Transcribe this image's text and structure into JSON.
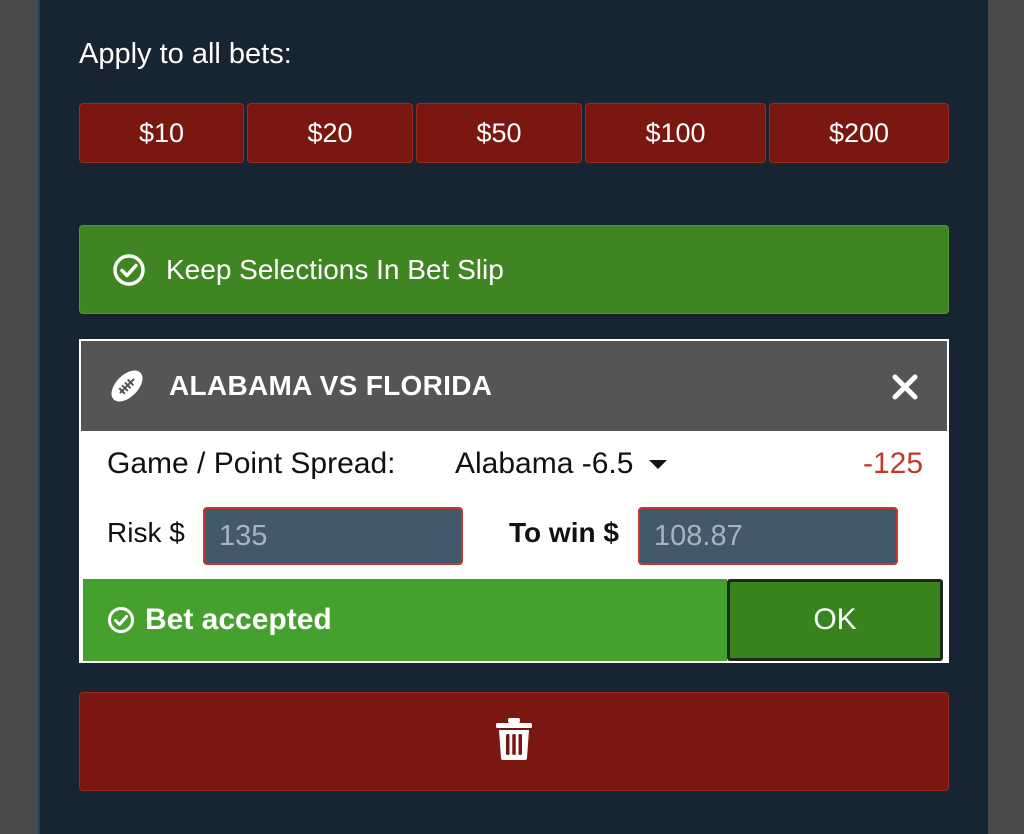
{
  "apply_all": {
    "label": "Apply to all bets:",
    "amounts": [
      "$10",
      "$20",
      "$50",
      "$100",
      "$200"
    ]
  },
  "keep_selections": {
    "label": "Keep Selections In Bet Slip",
    "icon": "check-circle-icon"
  },
  "bet_card": {
    "title": "ALABAMA VS FLORIDA",
    "sport_icon": "football-icon",
    "market_label": "Game / Point Spread:",
    "selection": "Alabama -6.5",
    "odds": "-125",
    "risk_label": "Risk $",
    "risk_value": "135",
    "to_win_label": "To win $",
    "to_win_value": "108.87",
    "status": "Bet accepted",
    "ok_label": "OK"
  },
  "delete": {
    "icon": "trash-icon"
  },
  "colors": {
    "background": "#172533",
    "red_button": "#7a1711",
    "green": "#3f8622",
    "odds_red": "#c0392b",
    "card_header": "#555555"
  }
}
